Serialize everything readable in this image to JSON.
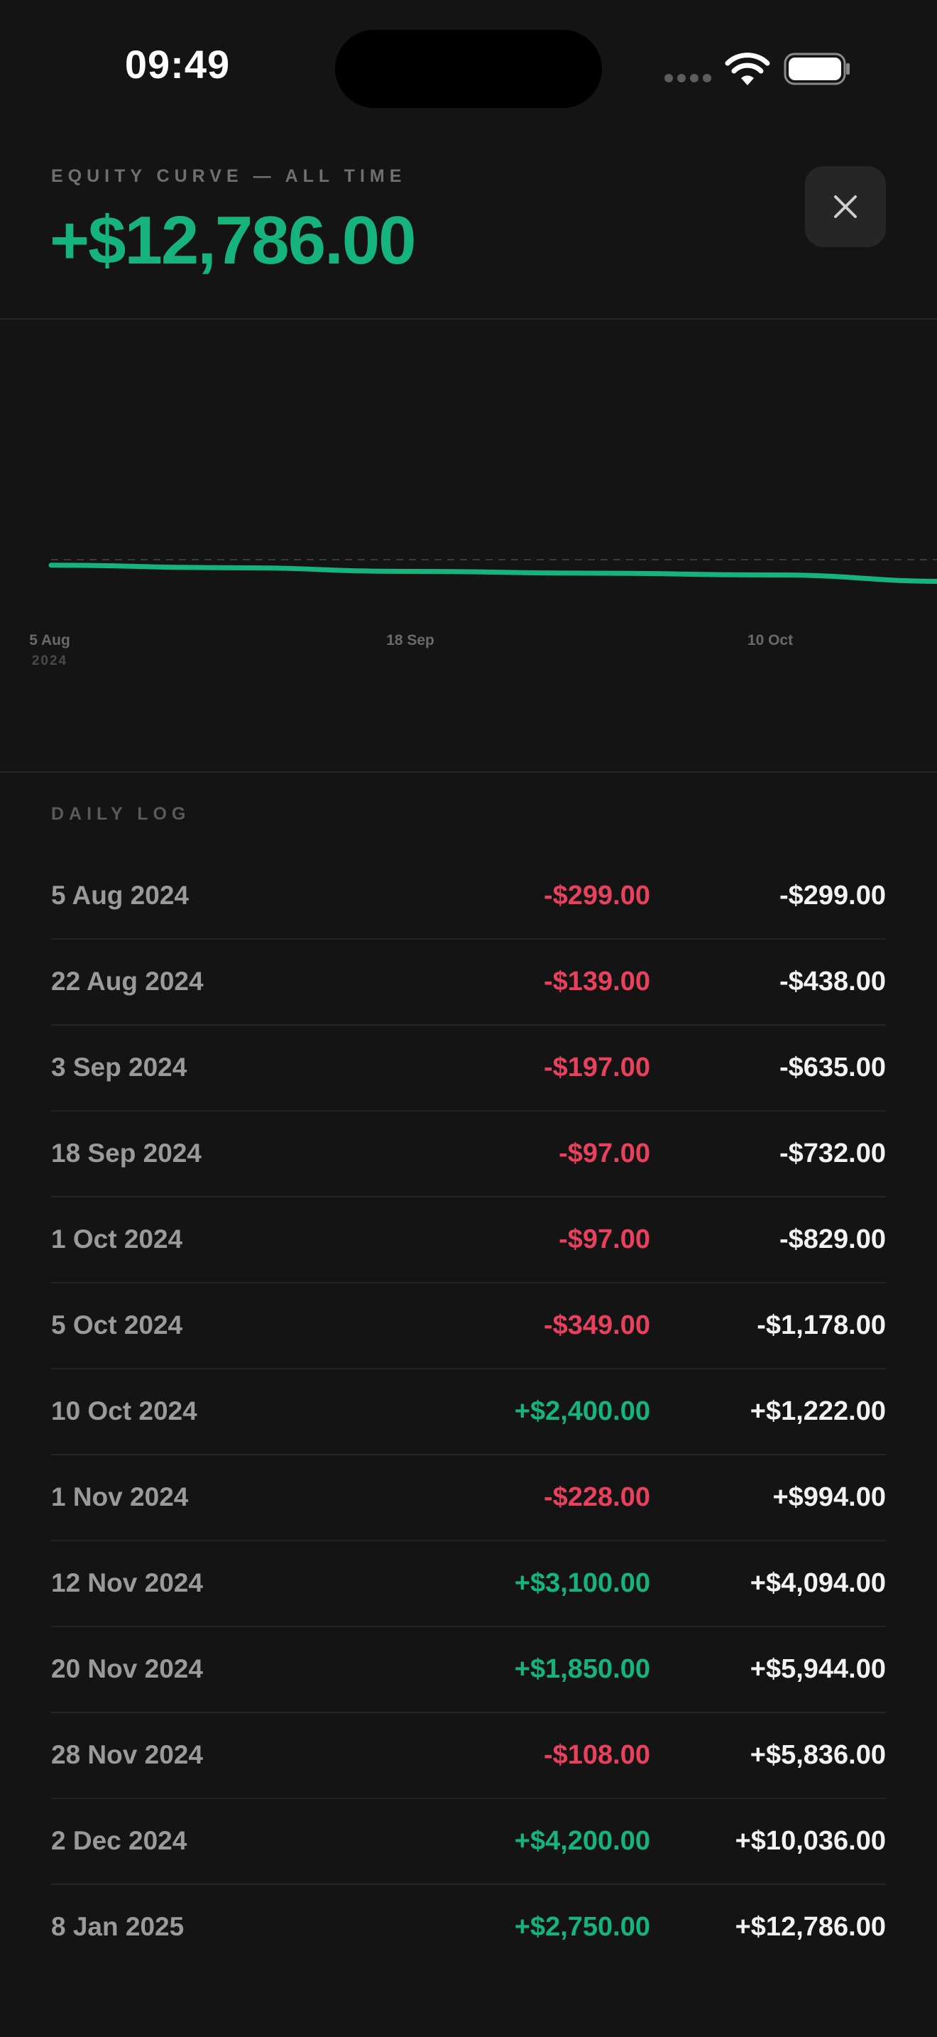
{
  "status_bar": {
    "time": "09:49",
    "icons": [
      "cellular-dots-icon",
      "wifi-icon",
      "battery-icon"
    ]
  },
  "header": {
    "eyebrow": "EQUITY CURVE — ALL TIME",
    "total": "+$12,786.00",
    "close_icon": "close-icon"
  },
  "colors": {
    "positive": "#17b37d",
    "negative": "#e8415d",
    "background": "#141414"
  },
  "chart_data": {
    "type": "line",
    "x_tick_labels": [
      {
        "label": "5 Aug",
        "sub": "2024"
      },
      {
        "label": "18 Sep",
        "sub": ""
      },
      {
        "label": "10 Oct",
        "sub": ""
      }
    ],
    "x": [
      "5 Aug 2024",
      "22 Aug 2024",
      "3 Sep 2024",
      "18 Sep 2024",
      "1 Oct 2024",
      "5 Oct 2024",
      "10 Oct 2024",
      "1 Nov 2024",
      "12 Nov 2024",
      "20 Nov 2024",
      "28 Nov 2024",
      "2 Dec 2024",
      "8 Jan 2025"
    ],
    "series": [
      {
        "values": [
          -299,
          -438,
          -635,
          -732,
          -829,
          -1178,
          1222,
          994,
          4094,
          5944,
          5836,
          10036,
          12786
        ]
      }
    ],
    "baseline": 0,
    "grid": false,
    "legend": "none"
  },
  "daily_log": {
    "heading": "DAILY LOG",
    "rows": [
      {
        "date": "5 Aug 2024",
        "change": "-$299.00",
        "cumulative": "-$299.00",
        "sign": "neg"
      },
      {
        "date": "22 Aug 2024",
        "change": "-$139.00",
        "cumulative": "-$438.00",
        "sign": "neg"
      },
      {
        "date": "3 Sep 2024",
        "change": "-$197.00",
        "cumulative": "-$635.00",
        "sign": "neg"
      },
      {
        "date": "18 Sep 2024",
        "change": "-$97.00",
        "cumulative": "-$732.00",
        "sign": "neg"
      },
      {
        "date": "1 Oct 2024",
        "change": "-$97.00",
        "cumulative": "-$829.00",
        "sign": "neg"
      },
      {
        "date": "5 Oct 2024",
        "change": "-$349.00",
        "cumulative": "-$1,178.00",
        "sign": "neg"
      },
      {
        "date": "10 Oct 2024",
        "change": "+$2,400.00",
        "cumulative": "+$1,222.00",
        "sign": "pos"
      },
      {
        "date": "1 Nov 2024",
        "change": "-$228.00",
        "cumulative": "+$994.00",
        "sign": "neg"
      },
      {
        "date": "12 Nov 2024",
        "change": "+$3,100.00",
        "cumulative": "+$4,094.00",
        "sign": "pos"
      },
      {
        "date": "20 Nov 2024",
        "change": "+$1,850.00",
        "cumulative": "+$5,944.00",
        "sign": "pos"
      },
      {
        "date": "28 Nov 2024",
        "change": "-$108.00",
        "cumulative": "+$5,836.00",
        "sign": "neg"
      },
      {
        "date": "2 Dec 2024",
        "change": "+$4,200.00",
        "cumulative": "+$10,036.00",
        "sign": "pos"
      },
      {
        "date": "8 Jan 2025",
        "change": "+$2,750.00",
        "cumulative": "+$12,786.00",
        "sign": "pos"
      }
    ]
  }
}
